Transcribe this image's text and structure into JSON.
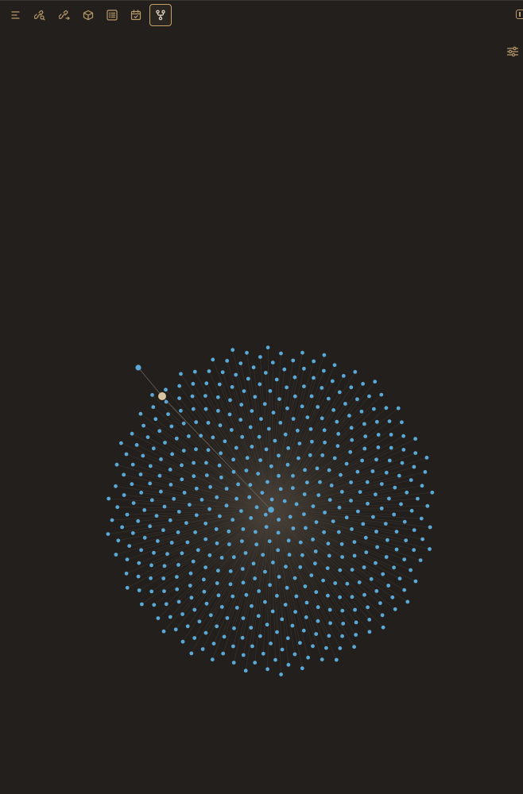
{
  "toolbar": {
    "buttons": [
      {
        "name": "file-explorer-button",
        "icon": "list-icon",
        "active": false
      },
      {
        "name": "search-button",
        "icon": "link-search-icon",
        "active": false
      },
      {
        "name": "outgoing-links-button",
        "icon": "link-arrow-icon",
        "active": false
      },
      {
        "name": "bookmarks-button",
        "icon": "cube-icon",
        "active": false
      },
      {
        "name": "outline-button",
        "icon": "outline-list-icon",
        "active": false
      },
      {
        "name": "calendar-button",
        "icon": "calendar-icon",
        "active": false
      },
      {
        "name": "graph-view-button",
        "icon": "git-fork-icon",
        "active": true
      }
    ]
  },
  "graph": {
    "colors": {
      "background": "#231f1c",
      "node": "#5aa9d6",
      "hub_node": "#5aa9d6",
      "selected_node": "#d9c3a0",
      "edge": "#4a433b",
      "accent": "#c7a262",
      "icon": "#b89a69"
    },
    "layout_shape": "radial cluster"
  }
}
